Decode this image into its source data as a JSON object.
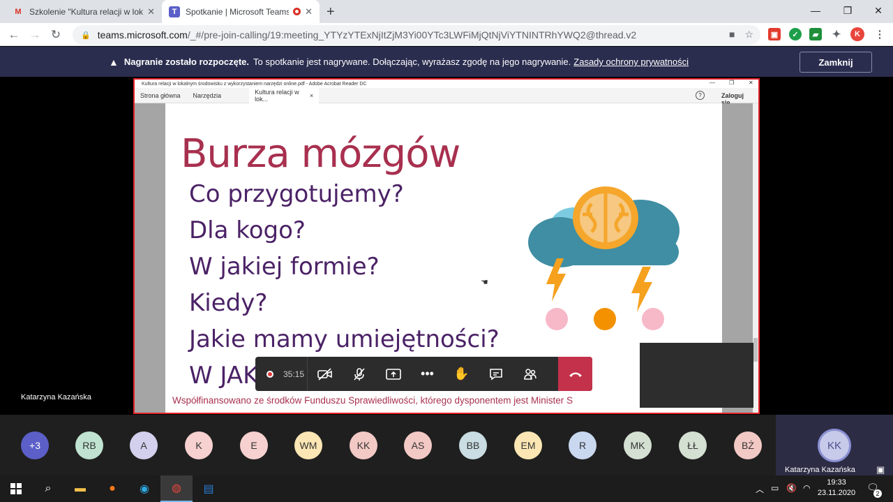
{
  "browser": {
    "tabs": [
      {
        "title": "Szkolenie \"Kultura relacji w lokaln",
        "icon": "gmail-icon"
      },
      {
        "title": "Spotkanie | Microsoft Teams",
        "icon": "teams-icon",
        "recording": true
      }
    ],
    "url_host": "teams.microsoft.com",
    "url_path": "/_#/pre-join-calling/19:meeting_YTYzYTExNjItZjM3Yi00YTc3LWFiMjQtNjViYTNINTRhYWQ2@thread.v2",
    "profile_initial": "K"
  },
  "banner": {
    "bold": "Nagranie zostało rozpoczęte.",
    "text": "To spotkanie jest nagrywane. Dołączając, wyrażasz zgodę na jego nagrywanie.",
    "link": "Zasady ochrony prywatności",
    "close_label": "Zamknij"
  },
  "acrobat": {
    "window_title": "Kultura relacji w lokalnym środowisku z wykorzystaniem narzędzi online.pdf - Adobe Acrobat Reader DC",
    "menu_home": "Strona główna",
    "menu_tools": "Narzędzia",
    "doc_tab": "Kultura relacji w lok...",
    "login": "Zaloguj się"
  },
  "slide": {
    "title": "Burza mózgów",
    "questions": [
      "Co przygotujemy?",
      "Dla kogo?",
      "W jakiej formie?",
      "Kiedy?",
      "Jakie mamy umiejętności?",
      "W JAKIM CELU?"
    ],
    "footer": "Współfinansowano ze środków Funduszu Sprawiedliwości, którego dysponentem jest Minister S"
  },
  "presenter": "Katarzyna Kazańska",
  "controls": {
    "timer": "35:15"
  },
  "participants": [
    {
      "initials": "+3",
      "color": "#5b5fc7"
    },
    {
      "initials": "RB",
      "color": "#bfe3d0"
    },
    {
      "initials": "A",
      "color": "#d3d0ee"
    },
    {
      "initials": "K",
      "color": "#f6d1cf"
    },
    {
      "initials": "E",
      "color": "#f6d1cf"
    },
    {
      "initials": "WM",
      "color": "#fbe6b4"
    },
    {
      "initials": "KK",
      "color": "#f3c9c5"
    },
    {
      "initials": "AS",
      "color": "#f3c9c5"
    },
    {
      "initials": "BB",
      "color": "#c9dde2"
    },
    {
      "initials": "EM",
      "color": "#fbe6b4"
    },
    {
      "initials": "R",
      "color": "#c9d8ef"
    },
    {
      "initials": "MK",
      "color": "#d4e0d2"
    },
    {
      "initials": "ŁŁ",
      "color": "#d4e0d2"
    },
    {
      "initials": "BŻ",
      "color": "#f3c9c5"
    }
  ],
  "self": {
    "initials": "KK",
    "name": "Katarzyna Kazańska"
  },
  "taskbar": {
    "time": "19:33",
    "date": "23.11.2020",
    "notifications": "2"
  }
}
